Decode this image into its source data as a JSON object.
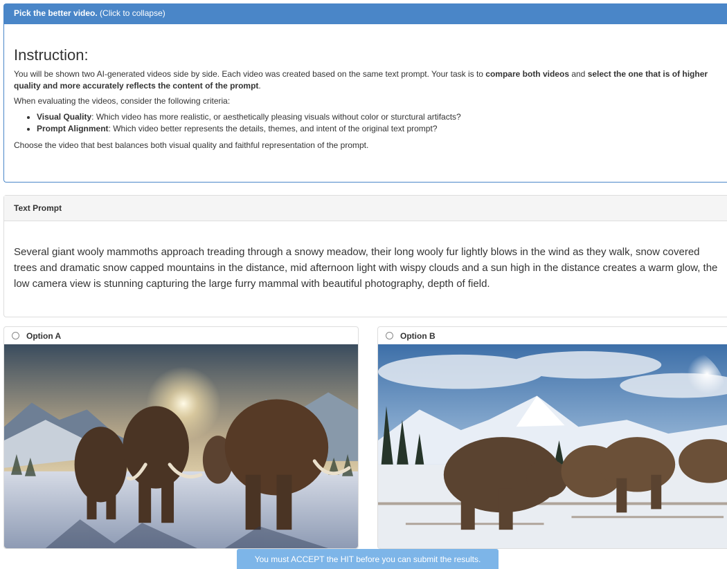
{
  "instructions": {
    "header_bold": "Pick the better video.",
    "header_hint": "(Click to collapse)",
    "title": "Instruction:",
    "intro_1": "You will be shown two AI-generated videos side by side. Each video was created based on the same text prompt. Your task is to ",
    "intro_bold_1": "compare both videos",
    "intro_2": " and ",
    "intro_bold_2": "select the one that is of higher quality and more accurately reflects the content of the prompt",
    "intro_3": ".",
    "criteria_lead": "When evaluating the videos, consider the following criteria:",
    "criteria": [
      {
        "term": "Visual Quality",
        "desc": ": Which video has more realistic, or aesthetically pleasing visuals without color or sturctural artifacts?"
      },
      {
        "term": "Prompt Alignment",
        "desc": ": Which video better represents the details, themes, and intent of the original text prompt?"
      }
    ],
    "closing": "Choose the video that best balances both visual quality and faithful representation of the prompt."
  },
  "prompt": {
    "header": "Text Prompt",
    "text": "Several giant wooly mammoths approach treading through a snowy meadow, their long wooly fur lightly blows in the wind as they walk, snow covered trees and dramatic snow capped mountains in the distance, mid afternoon light with wispy clouds and a sun high in the distance creates a warm glow, the low camera view is stunning capturing the large furry mammal with beautiful photography, depth of field."
  },
  "options": [
    {
      "label": "Option A",
      "selected": false
    },
    {
      "label": "Option B",
      "selected": false
    }
  ],
  "notice": "You must ACCEPT the HIT before you can submit the results.",
  "colors": {
    "header_blue": "#4a86c8",
    "notice_blue": "#7db5e8"
  }
}
